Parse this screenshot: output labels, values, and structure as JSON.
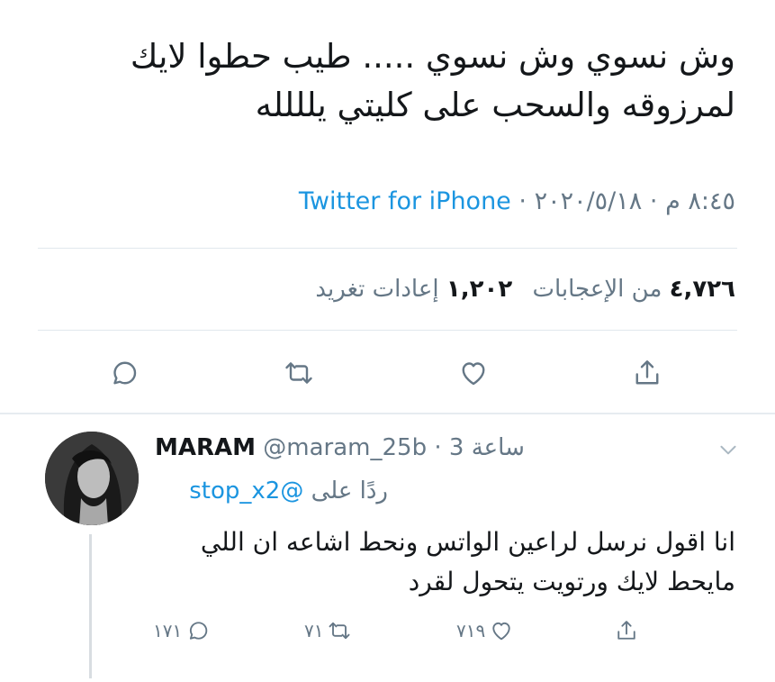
{
  "tweet": {
    "text_line1": "وش نسوي وش نسوي ..... طيب حطوا لايك",
    "text_line2": "لمرزوقه والسحب على كليتي يلللله",
    "time": "٨:٤٥ م",
    "date": "٢٠٢٠/٥/١٨",
    "separator": "·",
    "source": "Twitter for iPhone",
    "retweets_count": "١,٢٠٢",
    "retweets_label": "إعادات تغريد",
    "likes_count": "٤,٧٢٦",
    "likes_label": "من الإعجابات"
  },
  "reply": {
    "name": "MARAM",
    "handle": "@maram_25b",
    "separator": "·",
    "time": "3 ساعة",
    "reply_to_label": "ردًا على",
    "reply_to_handle": "@stop_x2",
    "text_line1": "انا اقول نرسل لراعين الواتس ونحط اشاعه ان اللي",
    "text_line2": "مايحط لايك ورتويت يتحول لقرد",
    "reply_count": "١٧١",
    "retweet_count": "٧١",
    "like_count": "٧١٩"
  },
  "icons": {
    "reply": "reply-icon",
    "retweet": "retweet-icon",
    "like": "heart-icon",
    "share": "share-icon",
    "menu": "chevron-down-icon"
  },
  "colors": {
    "link": "#1b95e0",
    "secondary_text": "#657786",
    "primary_text": "#14171a",
    "divider": "#e1e8ed"
  }
}
